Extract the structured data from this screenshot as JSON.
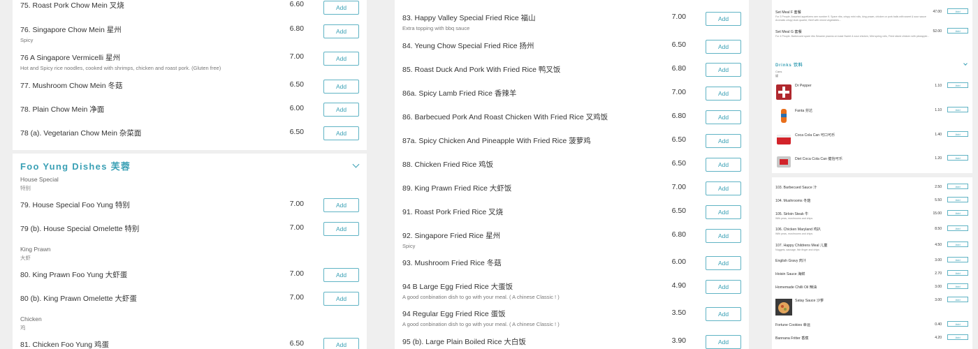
{
  "left_top": {
    "items": [
      {
        "name": "75. Roast Pork Chow Mein 叉烧",
        "desc": "",
        "price": "6.60",
        "add": "Add"
      },
      {
        "name": "76. Singapore Chow Mein 星州",
        "desc": "Spicy",
        "price": "6.80",
        "add": "Add"
      },
      {
        "name": "76 A Singapore Vermicelli 星州",
        "desc": "Hot and Spicy rice noodles, cooked with shrimps, chicken and roast pork. (Gluten free)",
        "price": "7.00",
        "add": "Add"
      },
      {
        "name": "77. Mushroom Chow Mein 冬菇",
        "desc": "",
        "price": "6.50",
        "add": "Add"
      },
      {
        "name": "78. Plain Chow Mein 净面",
        "desc": "",
        "price": "6.00",
        "add": "Add"
      },
      {
        "name": "78 (a). Vegetarian Chow Mein 杂菜面",
        "desc": "",
        "price": "6.50",
        "add": "Add"
      }
    ]
  },
  "foo_yung": {
    "title": "Foo Yung Dishes 芙蓉",
    "groups": [
      {
        "label": "House Special",
        "sub": "特别"
      },
      {
        "label": "King Prawn",
        "sub": "大虾"
      },
      {
        "label": "Chicken",
        "sub": "鸡"
      }
    ],
    "items": [
      {
        "name": "79. House Special Foo Yung 特别",
        "price": "7.00",
        "add": "Add"
      },
      {
        "name": "79 (b). House Special Omelette 特别",
        "price": "7.00",
        "add": "Add"
      },
      {
        "name": "80. King Prawn Foo Yung 大虾蛋",
        "price": "7.00",
        "add": "Add"
      },
      {
        "name": "80 (b). King Prawn Omelette 大虾蛋",
        "price": "7.00",
        "add": "Add"
      },
      {
        "name": "81. Chicken Foo Yung 鸡蛋",
        "price": "6.50",
        "add": "Add"
      }
    ]
  },
  "rice": {
    "items": [
      {
        "name": "83. Happy Valley Special Fried Rice 福山",
        "desc": "Extra topping with bbq sauce",
        "price": "7.00",
        "add": "Add"
      },
      {
        "name": "84. Yeung Chow Special Fried Rice 扬州",
        "desc": "",
        "price": "6.50",
        "add": "Add"
      },
      {
        "name": "85. Roast Duck And Pork With Fried Rice 鸭叉饭",
        "desc": "",
        "price": "6.80",
        "add": "Add"
      },
      {
        "name": "86a. Spicy Lamb Fried Rice 香辣羊",
        "desc": "",
        "price": "7.00",
        "add": "Add"
      },
      {
        "name": "86. Barbecued Pork And Roast Chicken With Fried Rice 叉鸡饭",
        "desc": "",
        "price": "6.80",
        "add": "Add"
      },
      {
        "name": "87a. Spicy Chicken And Pineapple With Fried Rice 菠萝鸡",
        "desc": "",
        "price": "6.50",
        "add": "Add"
      },
      {
        "name": "88. Chicken Fried Rice 鸡饭",
        "desc": "",
        "price": "6.50",
        "add": "Add"
      },
      {
        "name": "89. King Prawn Fried Rice 大虾饭",
        "desc": "",
        "price": "7.00",
        "add": "Add"
      },
      {
        "name": "91. Roast Pork Fried Rice 叉烧",
        "desc": "",
        "price": "6.50",
        "add": "Add"
      },
      {
        "name": "92. Singapore Fried Rice 星州",
        "desc": "Spicy",
        "price": "6.80",
        "add": "Add"
      },
      {
        "name": "93. Mushroom Fried Rice 冬菇",
        "desc": "",
        "price": "6.00",
        "add": "Add"
      },
      {
        "name": "94 B Large Egg Fried Rice 大蛋饭",
        "desc": "A good conbination dish to go with your meal. ( A chinese Classic ! )",
        "price": "4.90",
        "add": "Add"
      },
      {
        "name": "94 Regular Egg Fried Rice 蛋饭",
        "desc": "A good conbination dish to go with your meal. ( A chinese Classic ! )",
        "price": "3.50",
        "add": "Add"
      },
      {
        "name": "95 (b). Large Plain Boiled Rice 大白饭",
        "desc": "",
        "price": "3.90",
        "add": "Add"
      }
    ]
  },
  "right_top": {
    "set_meals": [
      {
        "name": "Set Meal F 套餐",
        "desc": "For 3 People. Assorted appetizers see number 9. Spare ribs, crispy mini rolls, king prawn, chicken or pork balls with sweet & sour sauce Aromatic crispy duck quarter, Beef with mixed vegetables...",
        "price": "47.00",
        "add": "Add"
      },
      {
        "name": "Set Meal G 套餐",
        "desc": "For 4 People. Barbecued spare ribs Sesame prawns on toast Sweet & sour chicken, Mini spring rolls, Fried sliced chicken with pineapple...",
        "price": "52.00",
        "add": "Add"
      }
    ],
    "drinks_title": "Drinks 饮料",
    "drinks_cat": "Cans",
    "drinks_cat_sub": "罐",
    "drinks": [
      {
        "name": "Dr Pepper",
        "price": "1.10",
        "add": "Add",
        "color": "#b0282e"
      },
      {
        "name": "Fanta 芬达",
        "price": "1.10",
        "add": "Add",
        "color": "#e86f1c"
      },
      {
        "name": "Coca Cola Can 可口可乐",
        "price": "1.40",
        "add": "Add",
        "color": "#d2232a"
      },
      {
        "name": "Diet Coca Cola Can 健怡可乐",
        "price": "1.20",
        "add": "Add",
        "color": "#b9b9b9"
      }
    ]
  },
  "right_bottom": {
    "items": [
      {
        "name": "103. Barbecued Sauce 汁",
        "desc": "",
        "price": "2.50",
        "add": "Add"
      },
      {
        "name": "104. Mushrooms 冬菇",
        "desc": "",
        "price": "5.50",
        "add": "Add"
      },
      {
        "name": "105. Sirloin Steak 牛",
        "desc": "With peas, mushrooms and chips",
        "price": "15.00",
        "add": "Add"
      },
      {
        "name": "106. Chicken Maryland 鸡扒",
        "desc": "With peas, mushrooms and chips",
        "price": "8.50",
        "add": "Add"
      },
      {
        "name": "107. Happy Childrens Meal 儿童",
        "desc": "Nuggets, sausage, fish finger and chips",
        "price": "4.50",
        "add": "Add"
      },
      {
        "name": "English Gravy 肉汁",
        "desc": "",
        "price": "3.00",
        "add": "Add"
      },
      {
        "name": "Hoisin Sauce 海鲜",
        "desc": "",
        "price": "2.70",
        "add": "Add"
      },
      {
        "name": "Homemade Chilli Oil 辣油",
        "desc": "",
        "price": "3.00",
        "add": "Add"
      },
      {
        "name": "Satay Sauce 沙爹",
        "desc": "",
        "price": "3.00",
        "add": "Add"
      },
      {
        "name": "Fortune Cookies 幸运",
        "desc": "",
        "price": "0.40",
        "add": "Add"
      },
      {
        "name": "Bannana Fritter 香蕉",
        "desc": "",
        "price": "4.20",
        "add": "Add"
      }
    ]
  }
}
